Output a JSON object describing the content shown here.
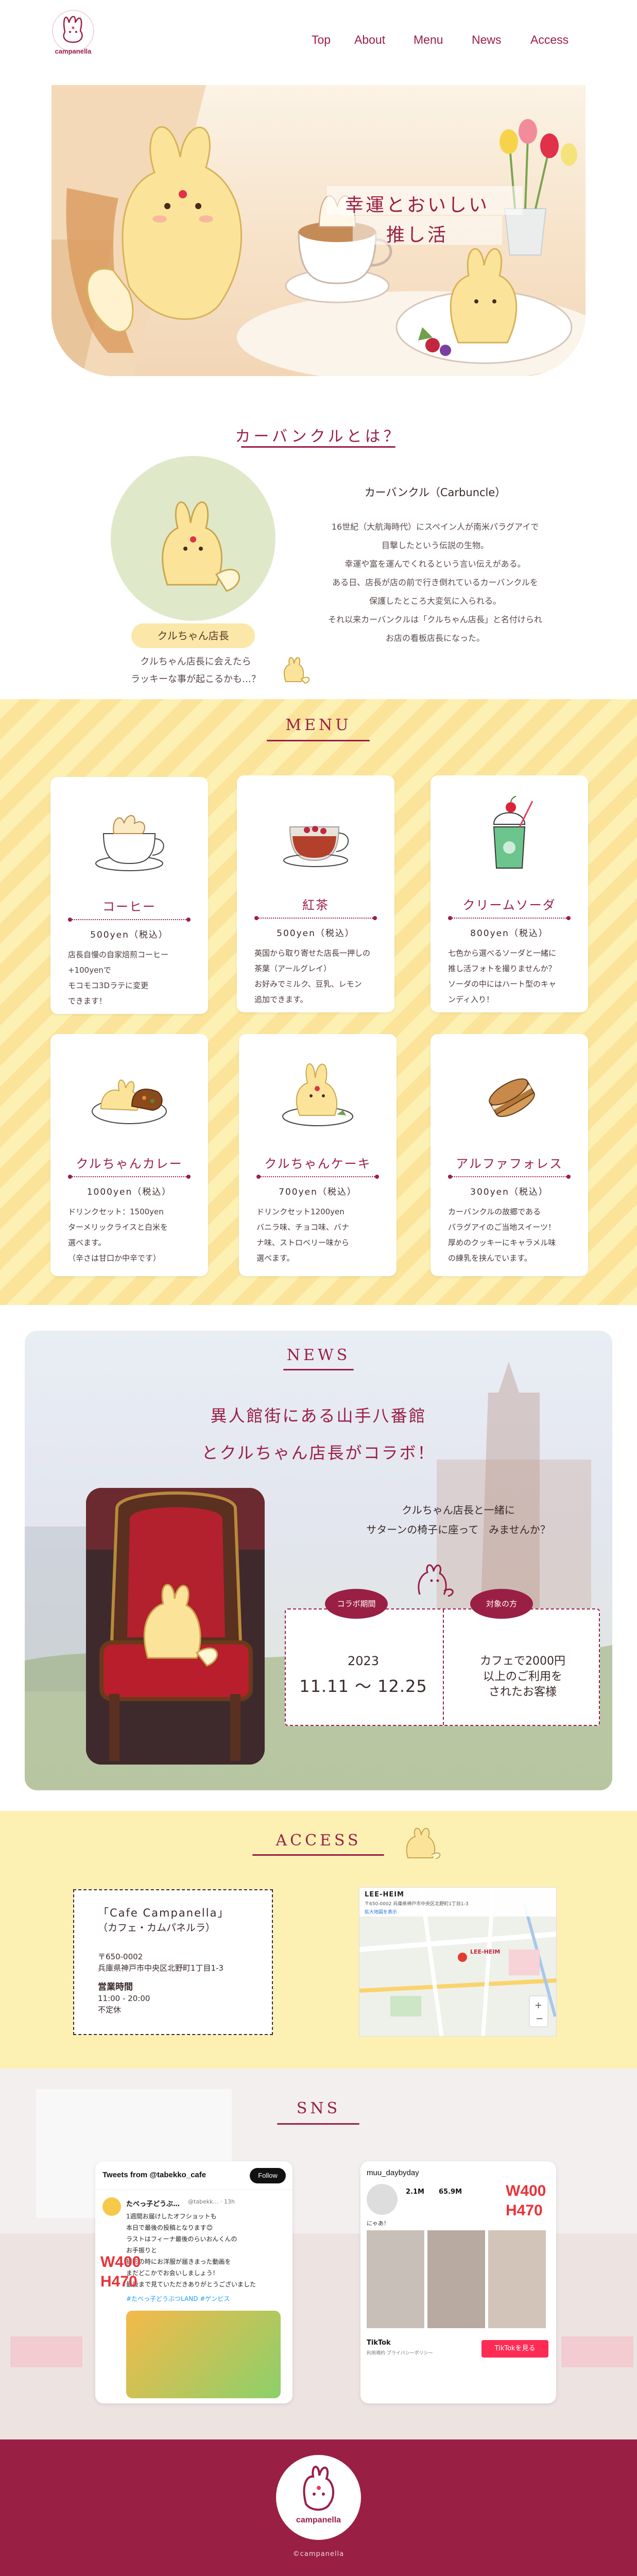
{
  "brand": {
    "logo_text": "campanella",
    "accent": "#9a1f45",
    "cream": "#fdf0b3"
  },
  "nav": {
    "items": [
      {
        "label": "Top"
      },
      {
        "label": "About"
      },
      {
        "label": "Menu"
      },
      {
        "label": "News"
      },
      {
        "label": "Access"
      }
    ]
  },
  "hero": {
    "tagline_line1": "幸運とおいしい",
    "tagline_line2": "推し活"
  },
  "about": {
    "title": "カーバンクルとは？",
    "badge": "クルちゃん店長",
    "caption_line1": "クルちゃん店長に会えたら",
    "caption_line2": "ラッキーな事が起こるかも…？",
    "heading": "カーバンクル（Carbuncle）",
    "body": [
      "16世紀（大航海時代）にスペイン人が南米パラグアイで",
      "目撃したという伝説の生物。",
      "幸運や富を運んでくれるという言い伝えがある。",
      "ある日、店長が店の前で行き倒れているカーバンクルを",
      "保護したところ大変気に入られる。",
      "それ以来カーバンクルは「クルちゃん店長」と名付けられ",
      "お店の看板店長になった。"
    ]
  },
  "menu": {
    "title": "MENU",
    "items": [
      {
        "name": "コーヒー",
        "price": "500yen（税込）",
        "desc": [
          "店長自慢の自家焙煎コーヒー",
          "+100yenで",
          "モコモコ3Dラテに変更",
          "できます！"
        ]
      },
      {
        "name": "紅茶",
        "price": "500yen（税込）",
        "desc": [
          "英国から取り寄せた店長一押しの",
          "茶葉（アールグレイ）",
          "お好みでミルク、豆乳、レモン",
          "追加できます。"
        ]
      },
      {
        "name": "クリームソーダ",
        "price": "800yen（税込）",
        "desc": [
          "七色から選べるソーダと一緒に",
          "推し活フォトを撮りませんか？",
          "ソーダの中にはハート型のキャ",
          "ンディ入り！"
        ]
      },
      {
        "name": "クルちゃんカレー",
        "price": "1000yen（税込）",
        "desc": [
          "ドリンクセット：1500yen",
          "ターメリックライスと白米を",
          "選べます。",
          "（辛さは甘口か中辛です）"
        ]
      },
      {
        "name": "クルちゃんケーキ",
        "price": "700yen（税込）",
        "desc": [
          "ドリンクセット1200yen",
          "バニラ味、チョコ味、バナ",
          "ナ味、ストロベリー味から",
          "選べます。"
        ]
      },
      {
        "name": "アルファフォレス",
        "price": "300yen（税込）",
        "desc": [
          "カーバンクルの故郷である",
          "パラグアイのご当地スイーツ！",
          "厚めのクッキーにキャラメル味",
          "の練乳を挟んでいます。"
        ]
      }
    ]
  },
  "news": {
    "title": "NEWS",
    "headline_line1": "異人館街にある山手八番館",
    "headline_line2": "とクルちゃん店長がコラボ！",
    "lead_line1": "クルちゃん店長と一緒に",
    "lead_line2": "サターンの椅子に座って　みませんか？",
    "tag_period": "コラボ期間",
    "tag_target": "対象の方",
    "year": "2023",
    "range": "11.11 ～ 12.25",
    "condition": [
      "カフェで2000円",
      "以上のご利用を",
      "されたお客様"
    ]
  },
  "access": {
    "title": "ACCESS",
    "shop_name": "「Cafe Campanella」",
    "shop_kana": "（カフェ・カムパネルラ）",
    "postal": "〒650-0002",
    "address": "兵庫県神戸市中央区北野町1丁目1-3",
    "hours_label": "営業時間",
    "hours": "11:00 - 20:00",
    "holiday": "不定休",
    "map_label": "LEE-HEIM",
    "map_sub": "〒650-0002 兵庫県神戸市中央区北野町1丁目1-3",
    "map_link": "拡大地図を表示",
    "map_pin": "LEE-HEIM"
  },
  "sns": {
    "title": "SNS",
    "twitter": {
      "header": "Tweets from @tabekko_cafe",
      "follow": "Follow",
      "user": "たべっ子どうぶ…",
      "handle": "@tabekk… · 13h",
      "lines": [
        "1週間お届けしたオフショットも",
        "本日で最後の投稿となります😊",
        "ラストはフィーナ最後のらいおんくんの",
        "お手振りと",
        "撮影の時にお洋服が届きまった動画を",
        "まだどこかでお会いしましょう！",
        "最後まで見ていただきありがとうございました"
      ],
      "tag": "#たべっ子どうぶつLAND #ゲンビス",
      "price1": "W400",
      "price2": "H470"
    },
    "tiktok": {
      "user": "muu_daybyday",
      "stat1": "2.1M",
      "stat2": "65.9M",
      "caption": "にゃあ！",
      "footer": "TikTok",
      "policy": "利用規約 プライバシーポリシー",
      "cta": "TikTokを見る",
      "price1": "W400",
      "price2": "H470"
    }
  },
  "footer": {
    "logo_text": "campanella",
    "copyright": "©campanella"
  }
}
